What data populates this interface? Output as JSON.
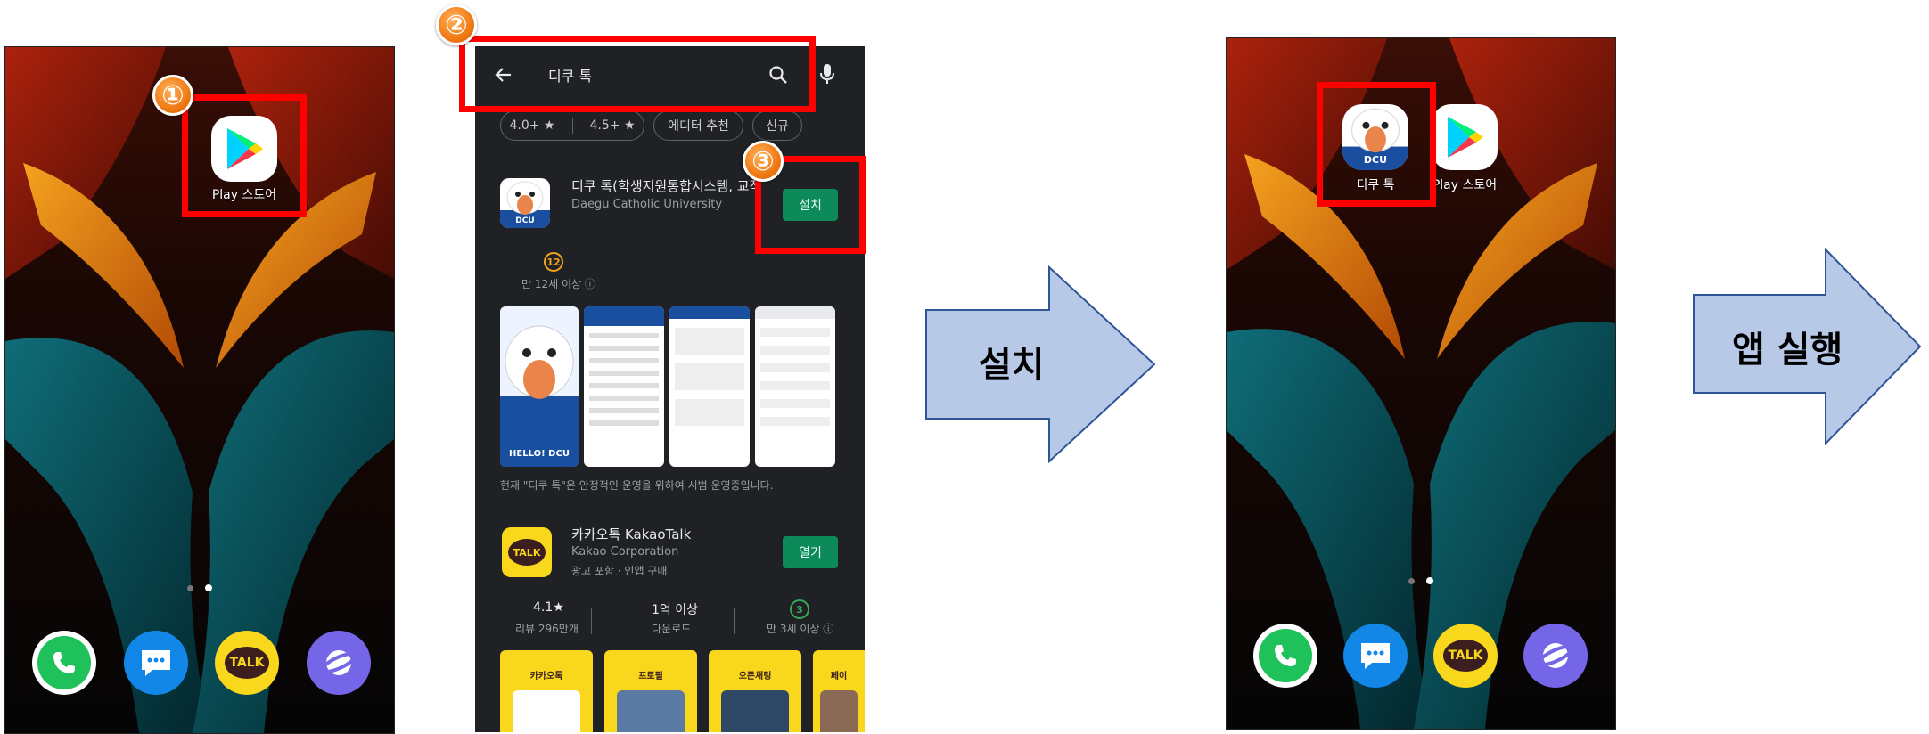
{
  "steps": {
    "one": "①",
    "two": "②",
    "three": "③"
  },
  "home_before": {
    "play_store_label": "Play 스토어",
    "dock": [
      "phone-icon",
      "messages-icon",
      "kakaotalk-icon",
      "internet-icon"
    ],
    "talk_text": "TALK"
  },
  "play_store": {
    "search_query": "디쿠 톡",
    "filters": [
      "4.0+ ★",
      "4.5+ ★",
      "에디터 추천",
      "신규"
    ],
    "app1": {
      "name": "디쿠 톡(학생지원통합시스템, 교직원",
      "developer": "Daegu Catholic University",
      "install_label": "설치",
      "age_badge": "12",
      "age_text": "만 12세 이상 ⓘ",
      "hello_text": "HELLO! DCU",
      "dcu_text": "DCU",
      "notice": "현재 \"디쿠 톡\"은 안정적인 운영을 위하여 시범 운영중입니다."
    },
    "app2": {
      "name": "카카오톡 KakaoTalk",
      "developer": "Kakao Corporation",
      "meta": "광고 포함 · 인앱 구매",
      "open_label": "열기",
      "talk_text": "TALK",
      "stats": [
        {
          "value": "4.1★",
          "label": "리뷰 296만개"
        },
        {
          "value": "1억 이상",
          "label": "다운로드"
        },
        {
          "value": "3",
          "label": "만 3세 이상 ⓘ"
        }
      ]
    },
    "banners": [
      "카카오톡",
      "프로필",
      "오픈채팅",
      "페이"
    ]
  },
  "arrow1": {
    "label": "설치"
  },
  "home_after": {
    "dcu_label": "디쿠 톡",
    "dcu_text": "DCU",
    "play_store_label": "Play 스토어",
    "talk_text": "TALK"
  },
  "arrow2": {
    "label": "앱 실행"
  }
}
